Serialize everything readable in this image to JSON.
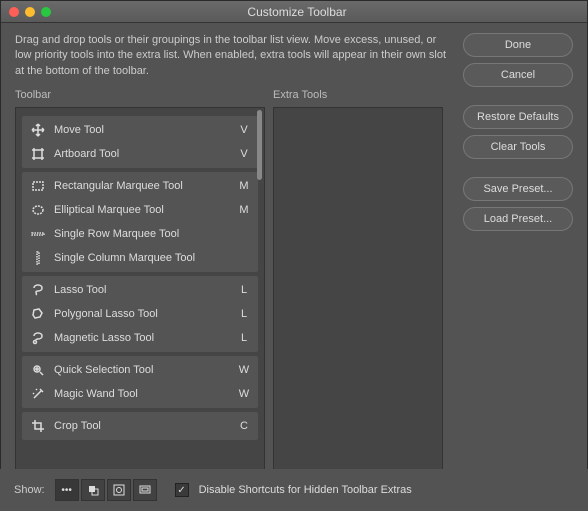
{
  "window": {
    "title": "Customize Toolbar",
    "description": "Drag and drop tools or their groupings in the toolbar list view. Move excess, unused, or low priority tools into the extra list. When enabled, extra tools will appear in their own slot at the bottom of the toolbar."
  },
  "columns": {
    "toolbar": "Toolbar",
    "extra": "Extra Tools"
  },
  "groups": [
    {
      "tools": [
        {
          "label": "Move Tool",
          "shortcut": "V",
          "icon": "move"
        },
        {
          "label": "Artboard Tool",
          "shortcut": "V",
          "icon": "artboard"
        }
      ]
    },
    {
      "tools": [
        {
          "label": "Rectangular Marquee Tool",
          "shortcut": "M",
          "icon": "rect-marquee"
        },
        {
          "label": "Elliptical Marquee Tool",
          "shortcut": "M",
          "icon": "ellipse-marquee"
        },
        {
          "label": "Single Row Marquee Tool",
          "shortcut": "",
          "icon": "row-marquee"
        },
        {
          "label": "Single Column Marquee Tool",
          "shortcut": "",
          "icon": "col-marquee"
        }
      ]
    },
    {
      "tools": [
        {
          "label": "Lasso Tool",
          "shortcut": "L",
          "icon": "lasso"
        },
        {
          "label": "Polygonal Lasso Tool",
          "shortcut": "L",
          "icon": "poly-lasso"
        },
        {
          "label": "Magnetic Lasso Tool",
          "shortcut": "L",
          "icon": "mag-lasso"
        }
      ]
    },
    {
      "tools": [
        {
          "label": "Quick Selection Tool",
          "shortcut": "W",
          "icon": "quick-sel"
        },
        {
          "label": "Magic Wand Tool",
          "shortcut": "W",
          "icon": "wand"
        }
      ]
    },
    {
      "tools": [
        {
          "label": "Crop Tool",
          "shortcut": "C",
          "icon": "crop"
        }
      ]
    }
  ],
  "buttons": {
    "done": "Done",
    "cancel": "Cancel",
    "restore": "Restore Defaults",
    "clear": "Clear Tools",
    "save": "Save Preset...",
    "load": "Load Preset..."
  },
  "footer": {
    "show": "Show:",
    "checkbox_label": "Disable Shortcuts for Hidden Toolbar Extras",
    "checked": true
  }
}
